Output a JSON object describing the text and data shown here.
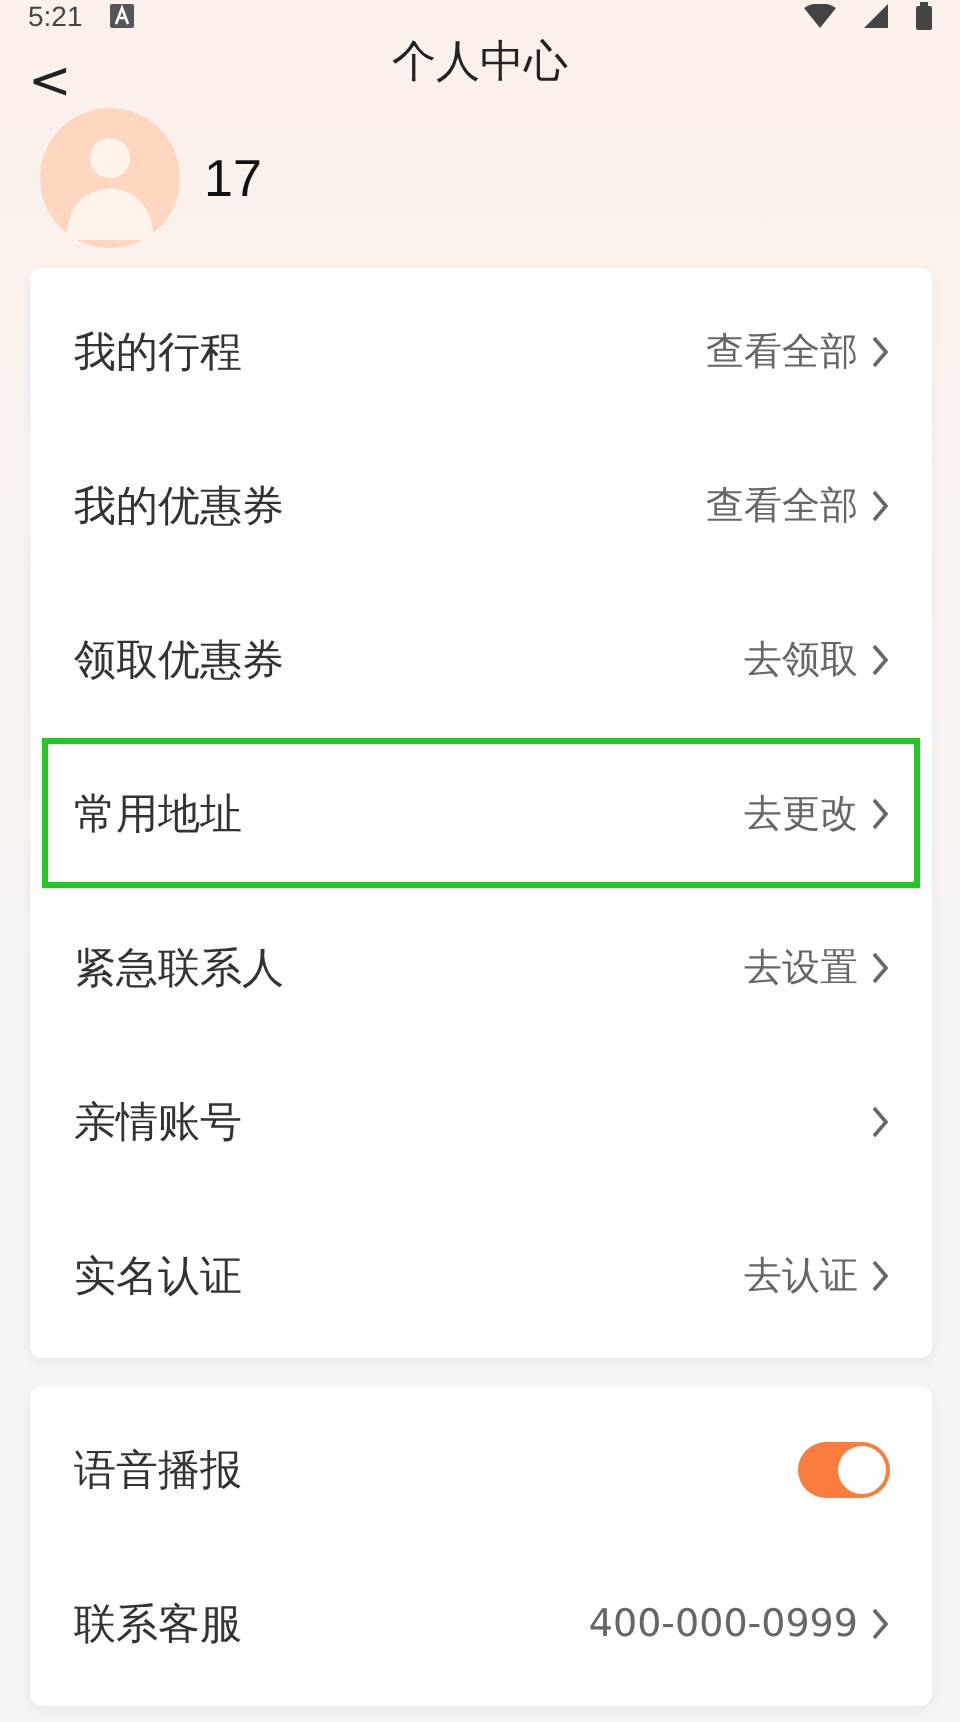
{
  "status_bar": {
    "time": "5:21"
  },
  "header": {
    "back": "<",
    "title": "个人中心"
  },
  "profile": {
    "name": "17"
  },
  "menu": [
    {
      "kind": "link",
      "label": "我的行程",
      "value": "查看全部",
      "highlighted": false
    },
    {
      "kind": "link",
      "label": "我的优惠券",
      "value": "查看全部",
      "highlighted": false
    },
    {
      "kind": "link",
      "label": "领取优惠券",
      "value": "去领取",
      "highlighted": false
    },
    {
      "kind": "link",
      "label": "常用地址",
      "value": "去更改",
      "highlighted": true
    },
    {
      "kind": "link",
      "label": "紧急联系人",
      "value": "去设置",
      "highlighted": false
    },
    {
      "kind": "link",
      "label": "亲情账号",
      "highlighted": false
    },
    {
      "kind": "link",
      "label": "实名认证",
      "value": "去认证",
      "highlighted": false
    }
  ],
  "settings": [
    {
      "kind": "toggle",
      "label": "语音播报",
      "on": true
    },
    {
      "kind": "link",
      "label": "联系客服",
      "value": "400-000-0999"
    }
  ]
}
